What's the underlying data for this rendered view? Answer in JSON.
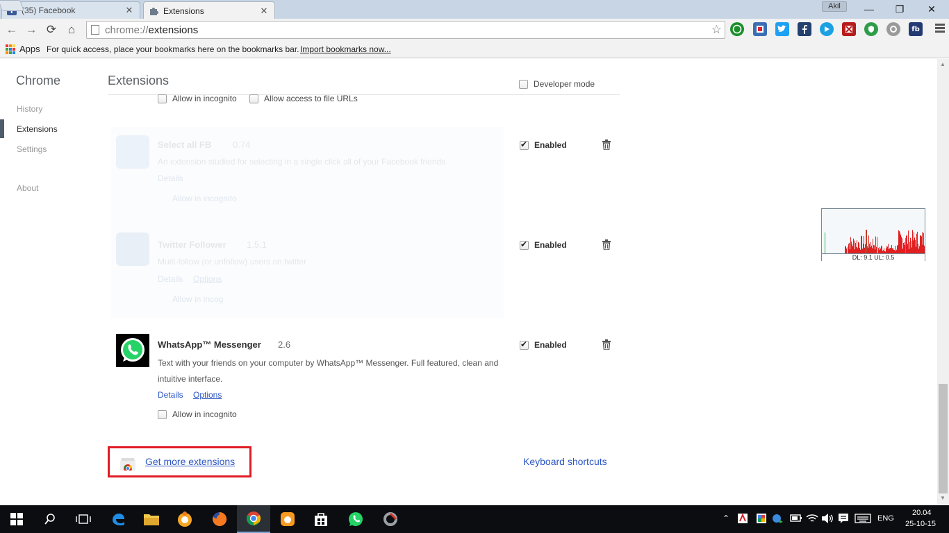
{
  "tabs": [
    {
      "title": "(35) Facebook",
      "close": "✕"
    },
    {
      "title": "Extensions",
      "close": "✕"
    }
  ],
  "profile_name": "Akil",
  "window_controls": {
    "minimize": "—",
    "maximize": "❐",
    "close": "✕"
  },
  "toolbar": {
    "url_scheme": "chrome://",
    "url_host": "extensions",
    "back_glyph": "←",
    "forward_glyph": "→",
    "reload_glyph": "⟳",
    "home_glyph": "⌂",
    "star_glyph": "☆",
    "fb_ext_label": "fb"
  },
  "bookmarks": {
    "apps_label": "Apps",
    "hint": "For quick access, place your bookmarks here on the bookmarks bar.",
    "import_link": "Import bookmarks now..."
  },
  "sidebar": {
    "title": "Chrome",
    "items": [
      "History",
      "Extensions",
      "Settings",
      "About"
    ]
  },
  "main": {
    "header": "Extensions",
    "developer_mode_label": "Developer mode",
    "top_row": {
      "incognito_label": "Allow in incognito",
      "file_urls_label": "Allow access to file URLs"
    },
    "extensions": [
      {
        "name": "Select all FB",
        "version": "0.74",
        "description": "An extension studied for selecting in a single click all of your Facebook friends",
        "details": "Details",
        "incognito": "Allow in incognito",
        "enabled_label": "Enabled"
      },
      {
        "name": "Twitter Follower",
        "version": "1.5.1",
        "description": "Multi-follow (or unfollow) users on twitter",
        "details": "Details",
        "options": "Options",
        "incognito": "Allow in incog",
        "enabled_label": "Enabled"
      },
      {
        "name": "WhatsApp™ Messenger",
        "version": "2.6",
        "description": "Text with your friends on your computer by WhatsApp™ Messenger. Full featured, clean and intuitive interface.",
        "details": "Details",
        "options": "Options",
        "incognito": "Allow in incognito",
        "enabled_label": "Enabled"
      }
    ],
    "get_more": "Get more extensions",
    "keyboard_shortcuts": "Keyboard shortcuts"
  },
  "net_meter": {
    "readout": "DL: 9.1 UL: 0.5"
  },
  "taskbar": {
    "lang": "ENG",
    "time": "20.04",
    "date": "25-10-15"
  },
  "colors": {
    "accent_link": "#2a55c2",
    "highlight_box": "#e01b24",
    "whatsapp_green": "#25d366",
    "facebook_blue": "#3b5998"
  }
}
